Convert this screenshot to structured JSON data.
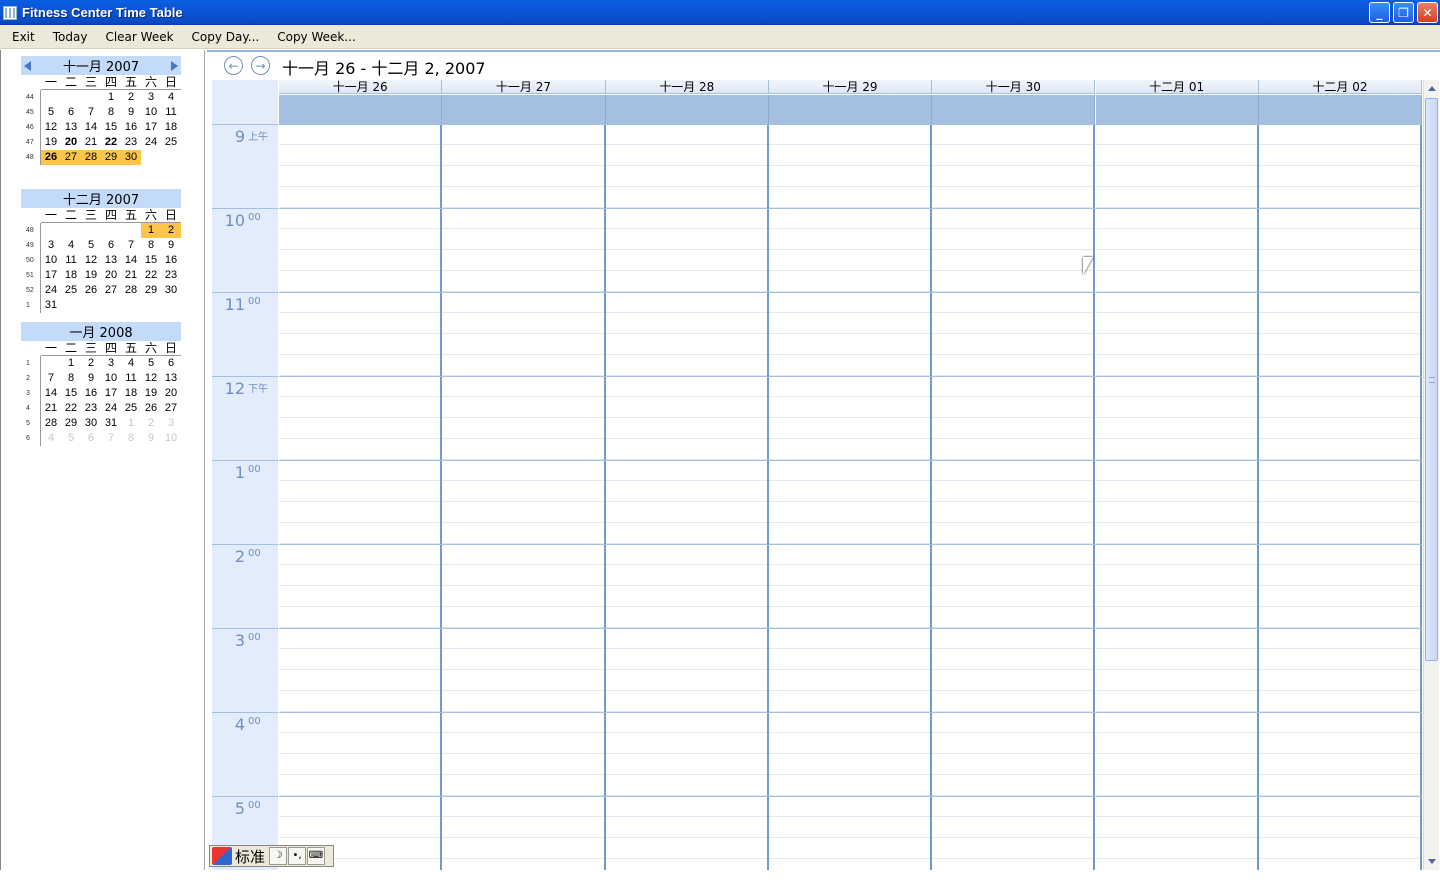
{
  "window": {
    "title": "Fitness Center Time Table",
    "icons": [
      "calendar-app-icon",
      "minimize-icon",
      "restore-icon",
      "close-icon"
    ]
  },
  "menu": {
    "exit": "Exit",
    "today": "Today",
    "clear_week": "Clear Week",
    "copy_day": "Copy Day...",
    "copy_week": "Copy Week..."
  },
  "mini_calendars": {
    "dow": [
      "一",
      "二",
      "三",
      "四",
      "五",
      "六",
      "日"
    ],
    "nov": {
      "title": "十一月 2007"
    },
    "dec": {
      "title": "十二月 2007"
    },
    "jan": {
      "title": "一月 2008"
    }
  },
  "week_view": {
    "range_title": "十一月 26 - 十二月 2, 2007",
    "days": [
      "十一月 26",
      "十一月 27",
      "十一月 28",
      "十一月 29",
      "十一月 30",
      "十二月 01",
      "十二月 02"
    ],
    "hours": [
      {
        "num": "9",
        "suffix": "上午"
      },
      {
        "num": "10",
        "suffix": "00"
      },
      {
        "num": "11",
        "suffix": "00"
      },
      {
        "num": "12",
        "suffix": "下午"
      },
      {
        "num": "1",
        "suffix": "00"
      },
      {
        "num": "2",
        "suffix": "00"
      },
      {
        "num": "3",
        "suffix": "00"
      },
      {
        "num": "4",
        "suffix": "00"
      },
      {
        "num": "5",
        "suffix": "00"
      }
    ]
  },
  "ime": {
    "label": "标准",
    "moon": "☽",
    "punct": "•,",
    "keyboard": "⌨"
  },
  "colors": {
    "titlebar": "#0a55d6",
    "selection": "#fbc54a",
    "grid_line": "#6f9ad4",
    "time_bg": "#e3ecfa",
    "allday_bg": "#a5bfe1"
  }
}
